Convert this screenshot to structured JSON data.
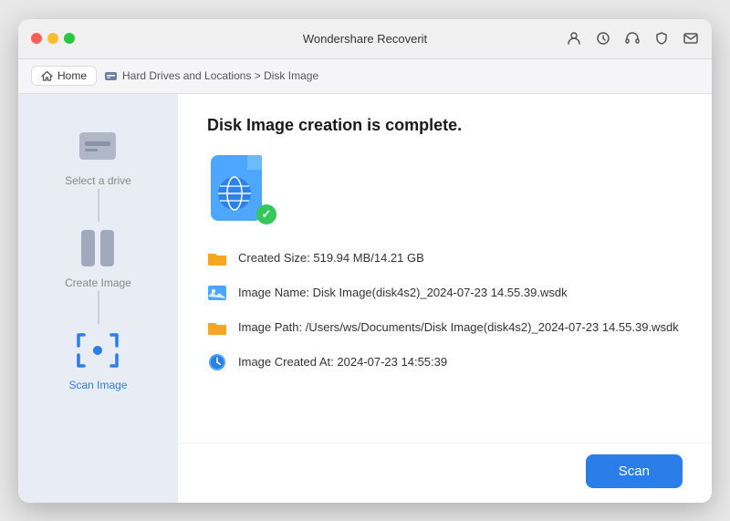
{
  "app": {
    "title": "Wondershare Recoverit",
    "traffic_lights": [
      "red",
      "yellow",
      "green"
    ]
  },
  "navbar": {
    "home_label": "Home",
    "breadcrumb": "Hard Drives and Locations > Disk Image"
  },
  "sidebar": {
    "steps": [
      {
        "label": "Select a drive",
        "active": false,
        "id": "select-drive"
      },
      {
        "label": "Create Image",
        "active": false,
        "id": "create-image"
      },
      {
        "label": "Scan Image",
        "active": true,
        "id": "scan-image"
      }
    ]
  },
  "content": {
    "title": "Disk Image creation is complete.",
    "info_items": [
      {
        "id": "created-size",
        "icon": "folder-orange",
        "text": "Created Size: 519.94 MB/14.21 GB"
      },
      {
        "id": "image-name",
        "icon": "image-blue",
        "text": "Image Name: Disk Image(disk4s2)_2024-07-23 14.55.39.wsdk"
      },
      {
        "id": "image-path",
        "icon": "folder-orange",
        "text": "Image Path: /Users/ws/Documents/Disk Image(disk4s2)_2024-07-23 14.55.39.wsdk"
      },
      {
        "id": "image-created",
        "icon": "clock-blue",
        "text": "Image Created At: 2024-07-23 14:55:39"
      }
    ]
  },
  "footer": {
    "scan_button": "Scan"
  }
}
